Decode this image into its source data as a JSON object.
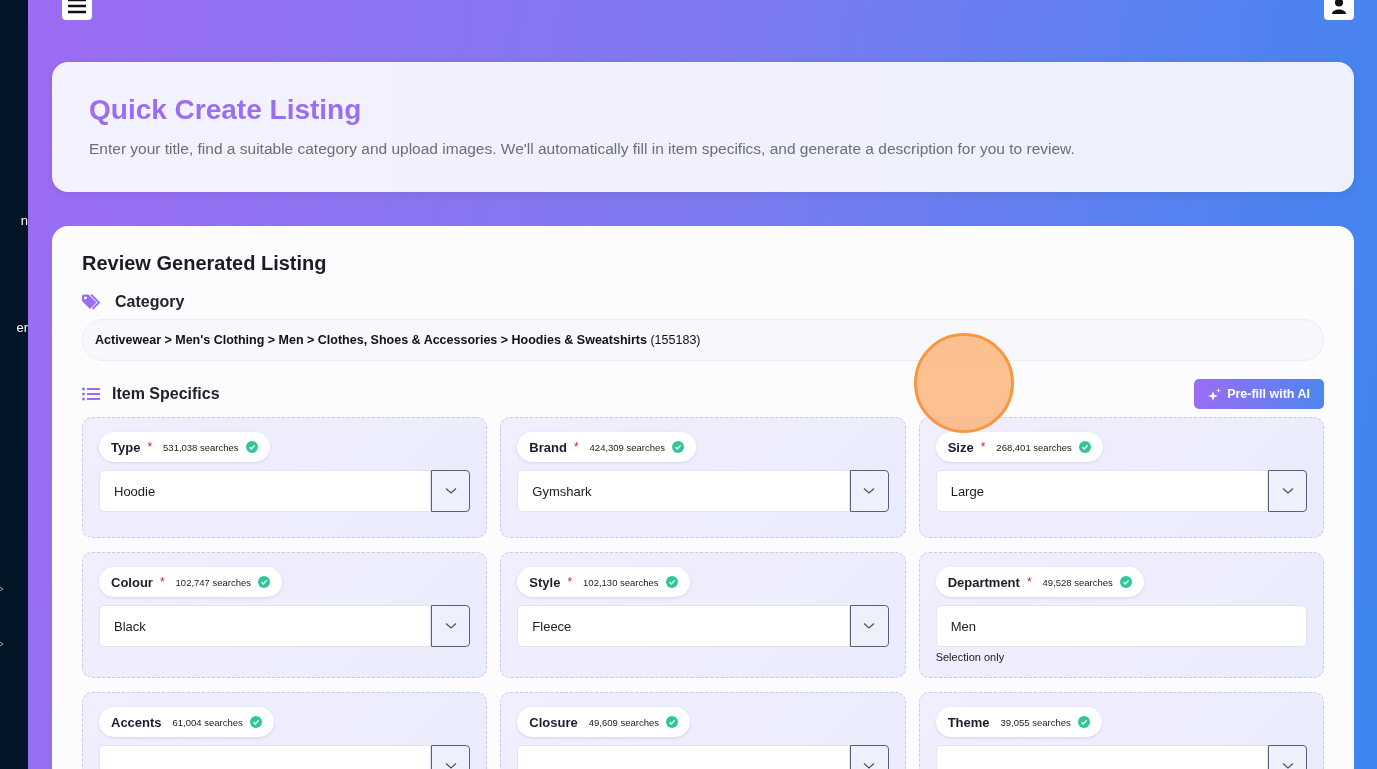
{
  "sidebar": {
    "items": [
      {
        "label": "n"
      },
      {
        "label": "er"
      }
    ]
  },
  "header": {
    "title": "Quick Create Listing",
    "subtitle": "Enter your title, find a suitable category and upload images. We'll automatically fill in item specifics, and generate a description for you to review."
  },
  "review": {
    "title": "Review Generated Listing",
    "category_label": "Category",
    "category_path": "**Activewear > Men's Clothing > Men > Clothes, Shoes & Accessories > Hoodies & Sweatshirts** (155183)",
    "specifics_label": "Item Specifics",
    "prefill_button": "Pre-fill with AI",
    "fields": [
      {
        "label": "Type",
        "required_mark": "*",
        "searches": "531,038 searches",
        "verified": true,
        "kind": "select",
        "value": "Hoodie"
      },
      {
        "label": "Brand",
        "required_mark": "*",
        "searches": "424,309 searches",
        "verified": true,
        "kind": "select",
        "value": "Gymshark"
      },
      {
        "label": "Size",
        "required_mark": "*",
        "searches": "268,401 searches",
        "verified": true,
        "kind": "select",
        "value": "Large"
      },
      {
        "label": "Colour",
        "required_mark": "*",
        "searches": "102,747 searches",
        "verified": true,
        "kind": "select",
        "value": "Black"
      },
      {
        "label": "Style",
        "required_mark": "*",
        "searches": "102,130 searches",
        "verified": true,
        "kind": "select",
        "value": "Fleece"
      },
      {
        "label": "Department",
        "required_mark": "*",
        "searches": "49,528 searches",
        "verified": true,
        "kind": "text",
        "value": "Men",
        "note": "Selection only"
      },
      {
        "label": "Accents",
        "searches": "61,004 searches",
        "verified": true,
        "kind": "select"
      },
      {
        "label": "Closure",
        "searches": "49,609 searches",
        "verified": true,
        "kind": "select"
      },
      {
        "label": "Theme",
        "searches": "39,055 searches",
        "verified": true,
        "kind": "select"
      }
    ]
  }
}
